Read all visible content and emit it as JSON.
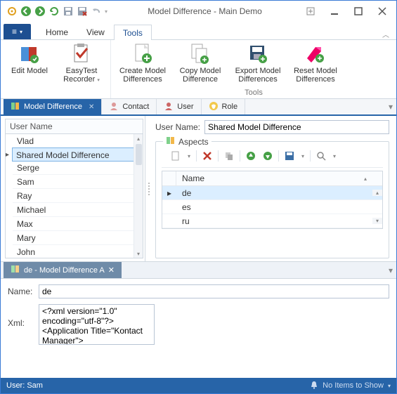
{
  "window": {
    "title": "Model Difference - Main Demo"
  },
  "ribbon": {
    "file": "≡",
    "tabs": [
      "Home",
      "View",
      "Tools"
    ],
    "activeTab": "Tools",
    "items": {
      "editModel": "Edit Model",
      "easyTest": "EasyTest Recorder",
      "createDiff": "Create Model Differences",
      "copyDiff": "Copy Model Difference",
      "exportDiff": "Export Model Differences",
      "resetDiff": "Reset Model Differences"
    },
    "groupLabel": "Tools"
  },
  "docTabs": {
    "main": {
      "label": "Model Difference"
    },
    "contact": {
      "label": "Contact"
    },
    "user": {
      "label": "User"
    },
    "role": {
      "label": "Role"
    }
  },
  "users": {
    "header": "User Name",
    "items": [
      "Vlad",
      "Shared Model Difference",
      "Serge",
      "Sam",
      "Ray",
      "Michael",
      "Max",
      "Mary",
      "John"
    ],
    "selectedIndex": 1
  },
  "form": {
    "userNameLabel": "User Name:",
    "userNameValue": "Shared Model Difference",
    "groupLabel": "Aspects"
  },
  "aspects": {
    "header": "Name",
    "items": [
      "de",
      "es",
      "ru"
    ],
    "selectedIndex": 0
  },
  "bottomTab": {
    "label": "de - Model Difference A"
  },
  "detail": {
    "nameLabel": "Name:",
    "nameValue": "de",
    "xmlLabel": "Xml:",
    "xmlValue": "<?xml version=\"1.0\" encoding=\"utf-8\"?>\n<Application Title=\"Kontact Manager\">\n    <NavigationItems"
  },
  "status": {
    "user": "User: Sam",
    "right": "No Items to Show"
  }
}
